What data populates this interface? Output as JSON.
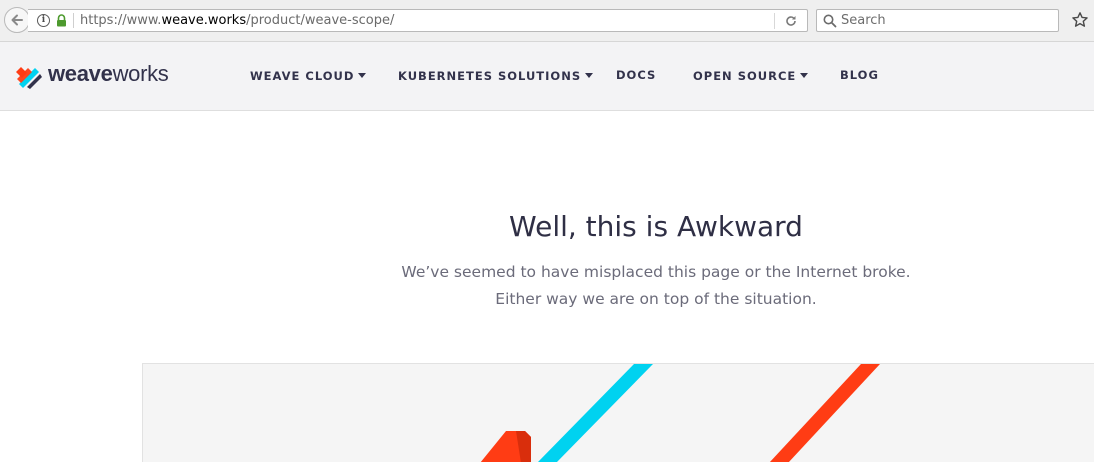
{
  "browser": {
    "url": {
      "prefix": "https://www.",
      "domain": "weave.works",
      "path": "/product/weave-scope/"
    },
    "search": {
      "placeholder": "Search"
    }
  },
  "site": {
    "logo": {
      "bold": "weave",
      "regular": "works"
    },
    "nav": [
      {
        "label": "WEAVE CLOUD",
        "has_dropdown": true
      },
      {
        "label": "KUBERNETES SOLUTIONS",
        "has_dropdown": true
      },
      {
        "label": "DOCS",
        "has_dropdown": false
      },
      {
        "label": "OPEN SOURCE",
        "has_dropdown": true
      },
      {
        "label": "BLOG",
        "has_dropdown": false
      }
    ]
  },
  "content": {
    "title": "Well, this is Awkward",
    "message_line1": "We’ve seemed to have misplaced this page or the Internet broke.",
    "message_line2": "Either way we are on top of the situation."
  },
  "colors": {
    "brand_dark": "#32324b",
    "accent_red": "#ff3c14",
    "accent_cyan": "#00d2f0",
    "lock_green": "#4d9a2e"
  }
}
